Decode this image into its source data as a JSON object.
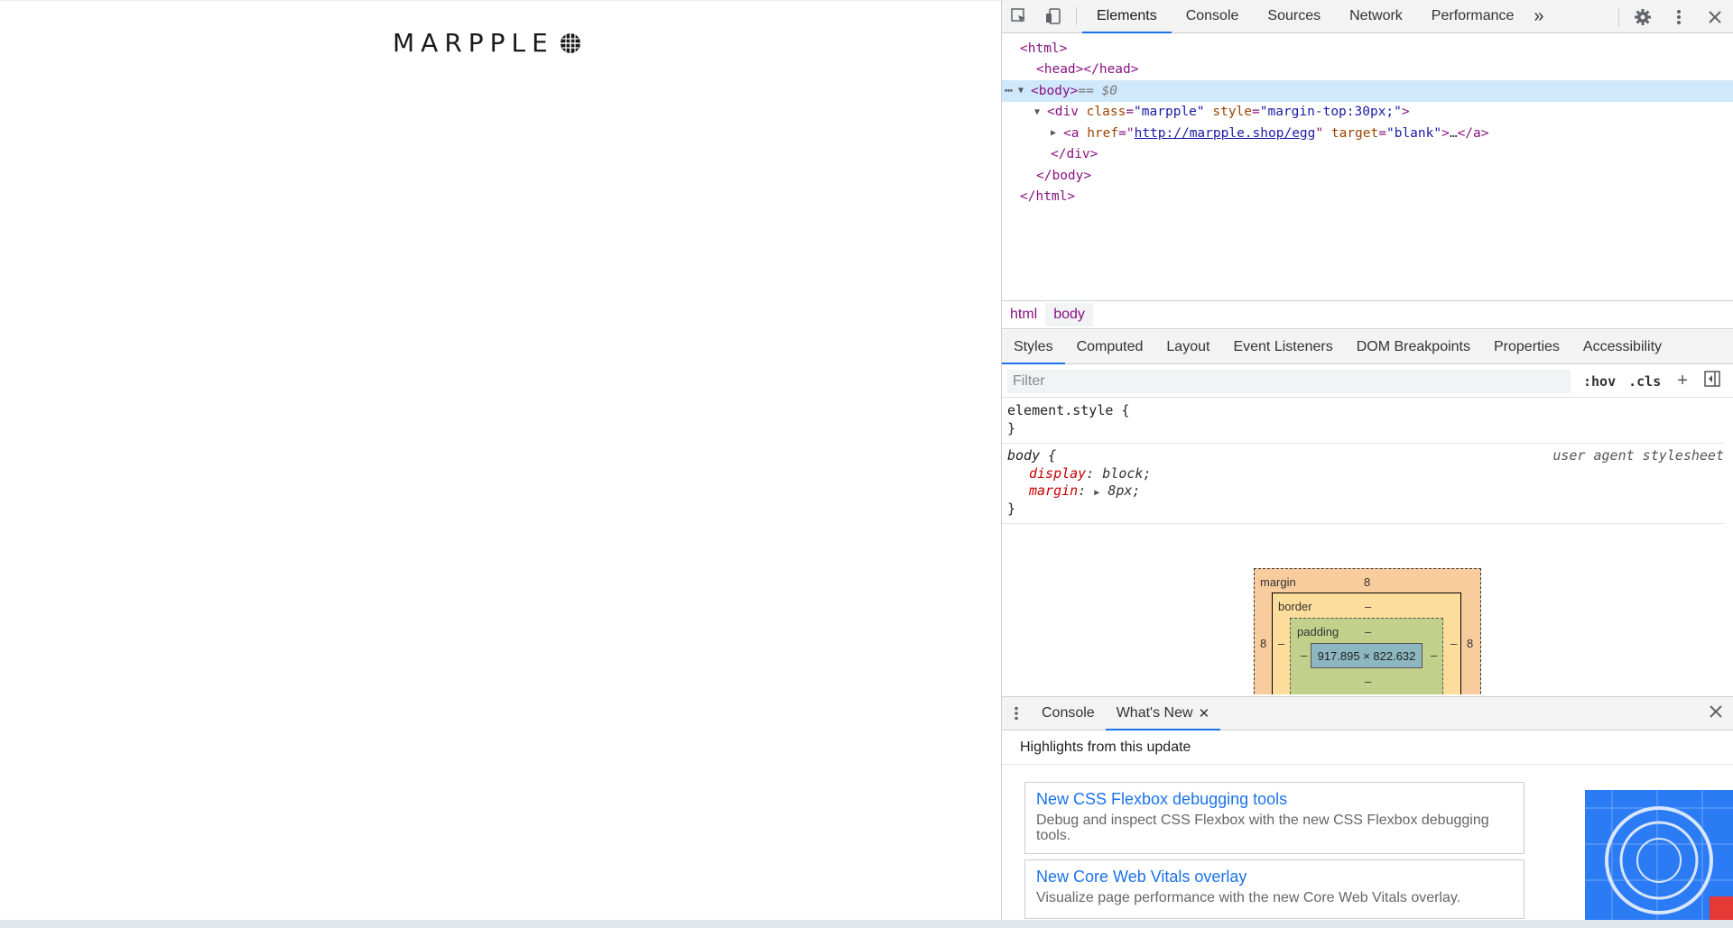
{
  "logo": {
    "text": "MARPPLE"
  },
  "devtools": {
    "main_tabs": [
      "Elements",
      "Console",
      "Sources",
      "Network",
      "Performance"
    ],
    "more_tabs_glyph": "»",
    "dom": {
      "line_html": "<html>",
      "line_head_open": "<head>",
      "line_head_close": "</head>",
      "body_tag": "<body>",
      "body_suffix": " == $0",
      "div_class_attr": "class",
      "div_class_val": "\"marpple\"",
      "div_style_attr": "style",
      "div_style_val": "\"margin-top:30px;\"",
      "a_href_attr": "href",
      "a_href_val": "http://marpple.shop/egg",
      "a_target_attr": "target",
      "a_target_val": "\"blank\"",
      "a_ellipsis": "…",
      "a_close": "</a>",
      "div_close": "</div>",
      "body_close": "</body>",
      "html_close": "</html>"
    },
    "breadcrumb": [
      "html",
      "body"
    ],
    "sub_tabs": [
      "Styles",
      "Computed",
      "Layout",
      "Event Listeners",
      "DOM Breakpoints",
      "Properties",
      "Accessibility"
    ],
    "filter": {
      "placeholder": "Filter",
      "hov": ":hov",
      "cls": ".cls"
    },
    "styles": {
      "element_style": "element.style {",
      "close_brace": "}",
      "body_selector": "body {",
      "source": "user agent stylesheet",
      "prop1_name": "display",
      "prop1_val": "block;",
      "prop2_name": "margin",
      "prop2_val": "8px;"
    },
    "box_model": {
      "margin_label": "margin",
      "margin_top": "8",
      "margin_left": "8",
      "margin_right": "8",
      "border_label": "border",
      "border_top": "–",
      "border_left": "–",
      "border_right": "–",
      "padding_label": "padding",
      "padding_top": "–",
      "padding_left": "–",
      "padding_right": "–",
      "padding_bottom": "–",
      "content_size": "917.895 × 822.632"
    },
    "drawer": {
      "tabs": [
        "Console",
        "What's New"
      ],
      "heading": "Highlights from this update",
      "cards": [
        {
          "title": "New CSS Flexbox debugging tools",
          "desc": "Debug and inspect CSS Flexbox with the new CSS Flexbox debugging tools."
        },
        {
          "title": "New Core Web Vitals overlay",
          "desc": "Visualize page performance with the new Core Web Vitals overlay."
        }
      ]
    }
  },
  "colors": {
    "accent": "#1a73e8",
    "tag": "#881280",
    "attr_name": "#994500",
    "attr_value": "#1a1aa6"
  }
}
